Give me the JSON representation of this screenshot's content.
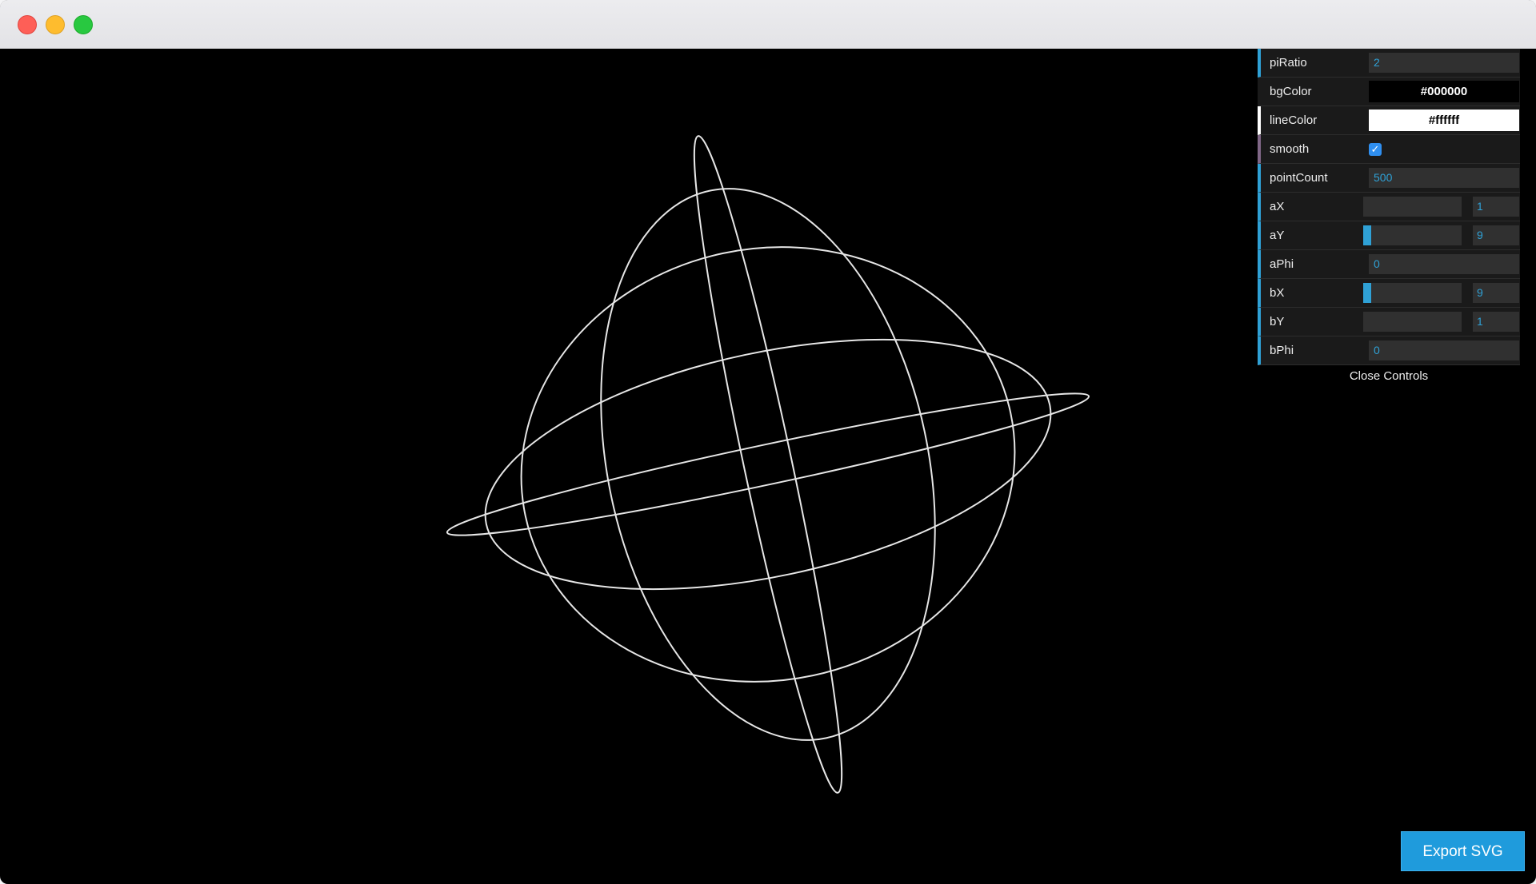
{
  "controls": {
    "piRatio": {
      "label": "piRatio",
      "value": "2"
    },
    "bgColor": {
      "label": "bgColor",
      "value": "#000000"
    },
    "lineColor": {
      "label": "lineColor",
      "value": "#ffffff"
    },
    "smooth": {
      "label": "smooth",
      "checked": true,
      "check_glyph": "✓"
    },
    "pointCount": {
      "label": "pointCount",
      "value": "500"
    },
    "aX": {
      "label": "aX",
      "value": "1",
      "level": 0
    },
    "aY": {
      "label": "aY",
      "value": "9",
      "level": 0.08
    },
    "aPhi": {
      "label": "aPhi",
      "value": "0"
    },
    "bX": {
      "label": "bX",
      "value": "9",
      "level": 0.08
    },
    "bY": {
      "label": "bY",
      "value": "1",
      "level": 0
    },
    "bPhi": {
      "label": "bPhi",
      "value": "0"
    },
    "close_label": "Close Controls"
  },
  "export_label": "Export SVG",
  "colors": {
    "accent": "#2fa1d6",
    "checkbox": "#2f8ff0",
    "button": "#1f9bdc",
    "curve": "#e8e8e8"
  }
}
